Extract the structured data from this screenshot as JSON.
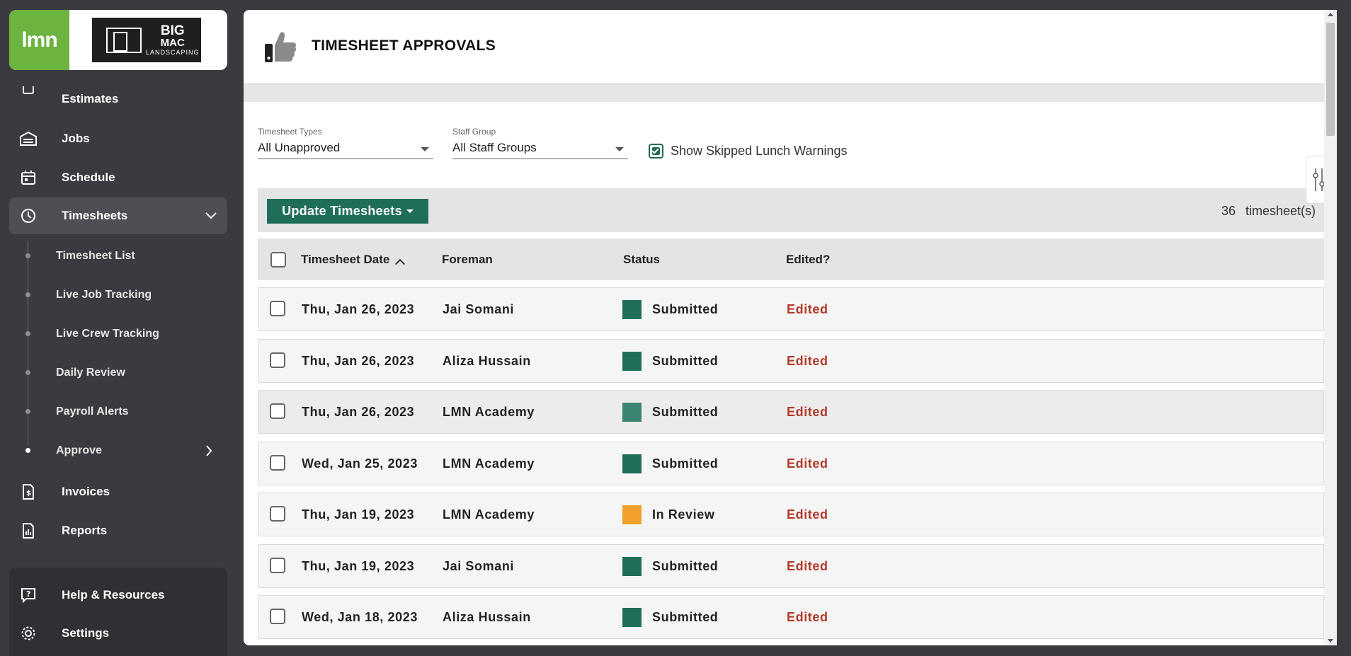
{
  "brand": {
    "lmn_logo": "lmn",
    "company_big": "BIG",
    "company_mac": "MAC",
    "company_landscaping": "LANDSCAPING"
  },
  "sidebar": {
    "partial_item": "Estimates",
    "items": [
      {
        "label": "Jobs",
        "icon": "jobs-icon"
      },
      {
        "label": "Schedule",
        "icon": "calendar-icon"
      },
      {
        "label": "Timesheets",
        "icon": "clock-icon"
      }
    ],
    "sub_items": [
      {
        "label": "Timesheet List"
      },
      {
        "label": "Live Job Tracking"
      },
      {
        "label": "Live Crew Tracking"
      },
      {
        "label": "Daily Review"
      },
      {
        "label": "Payroll Alerts"
      },
      {
        "label": "Approve"
      }
    ],
    "bottom_items": [
      {
        "label": "Invoices",
        "icon": "invoice-icon"
      },
      {
        "label": "Reports",
        "icon": "reports-icon"
      }
    ],
    "footer_items": [
      {
        "label": "Help & Resources",
        "icon": "help-icon"
      },
      {
        "label": "Settings",
        "icon": "gear-icon"
      }
    ]
  },
  "page": {
    "title": "TIMESHEET APPROVALS",
    "icon": "thumbs-up-icon"
  },
  "filters": {
    "types_label": "Timesheet Types",
    "types_value": "All Unapproved",
    "staff_label": "Staff Group",
    "staff_value": "All Staff Groups",
    "skipped_lunch_label": "Show Skipped Lunch Warnings",
    "skipped_lunch_checked": true
  },
  "toolbar": {
    "update_label": "Update Timesheets",
    "count": "36",
    "count_suffix": "timesheet(s)"
  },
  "table": {
    "headers": {
      "date": "Timesheet Date",
      "foreman": "Foreman",
      "status": "Status",
      "edited": "Edited?"
    },
    "rows": [
      {
        "date": "Thu, Jan 26, 2023",
        "foreman": "Jai Somani",
        "status": "Submitted",
        "status_color": "#1f6e5a",
        "edited": "Edited"
      },
      {
        "date": "Thu, Jan 26, 2023",
        "foreman": "Aliza Hussain",
        "status": "Submitted",
        "status_color": "#1f6e5a",
        "edited": "Edited"
      },
      {
        "date": "Thu, Jan 26, 2023",
        "foreman": "LMN Academy",
        "status": "Submitted",
        "status_color": "#3a8572",
        "edited": "Edited"
      },
      {
        "date": "Wed, Jan 25, 2023",
        "foreman": "LMN Academy",
        "status": "Submitted",
        "status_color": "#1f6e5a",
        "edited": "Edited"
      },
      {
        "date": "Thu, Jan 19, 2023",
        "foreman": "LMN Academy",
        "status": "In Review",
        "status_color": "#f0a12b",
        "edited": "Edited"
      },
      {
        "date": "Thu, Jan 19, 2023",
        "foreman": "Jai Somani",
        "status": "Submitted",
        "status_color": "#1f6e5a",
        "edited": "Edited"
      },
      {
        "date": "Wed, Jan 18, 2023",
        "foreman": "Aliza Hussain",
        "status": "Submitted",
        "status_color": "#1f6e5a",
        "edited": "Edited"
      }
    ]
  },
  "colors": {
    "accent": "#1f6e5a",
    "edited": "#b23a2a",
    "sidebar_bg": "#3a3b40",
    "lmn_green": "#6cb33f"
  }
}
